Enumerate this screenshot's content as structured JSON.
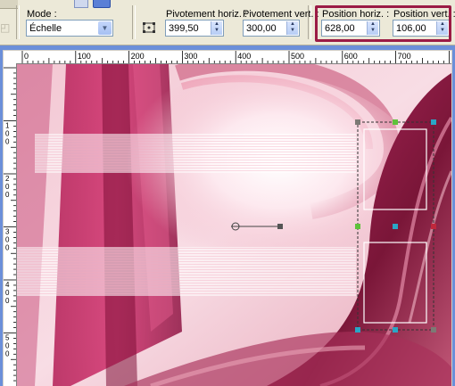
{
  "toolbar": {
    "mode_label": "Mode :",
    "mode_value": "Échelle",
    "pivot_h_label": "Pivotement horiz. :",
    "pivot_h_value": "399,50",
    "pivot_v_label": "Pivotement vert. :",
    "pivot_v_value": "300,00",
    "pos_h_label": "Position horiz. :",
    "pos_h_value": "628,00",
    "pos_v_label": "Position vert. :",
    "pos_v_value": "106,00"
  },
  "ruler": {
    "h_ticks": [
      "0",
      "100",
      "200",
      "300",
      "400",
      "500",
      "600",
      "700"
    ],
    "v_ticks": [
      "1\n0\n0",
      "2\n0\n0",
      "3\n0\n0",
      "4\n0\n0",
      "5\n0\n0"
    ]
  },
  "colors": {
    "highlight": "#9b1b45",
    "window_frame": "#6b8fd9",
    "handle_green": "#5fc23b",
    "handle_teal": "#2aa6c6",
    "handle_red": "#c0283c"
  }
}
